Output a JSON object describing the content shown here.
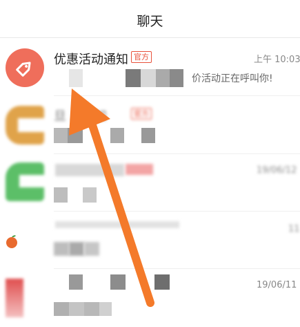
{
  "header": {
    "title": "聊天"
  },
  "chats": [
    {
      "name": "优惠活动通知",
      "badge": "官方",
      "time": "上午 10:03",
      "preview": "价活动正在呼叫你!",
      "avatar_color": "#ef6e5b",
      "avatar_icon": "tag-icon"
    },
    {
      "name": "旦 ...通知",
      "badge": "官方",
      "time": "",
      "preview": "",
      "avatar_color": "#e0a34a"
    },
    {
      "name": "",
      "badge": "",
      "time": "19/06/12",
      "preview": "",
      "avatar_color": "#5cbf68"
    },
    {
      "name": "",
      "badge": "",
      "time": "11",
      "preview": "",
      "avatar_color": "#e86a2e"
    },
    {
      "name": "",
      "badge": "",
      "time": "19/06/11",
      "preview": "",
      "avatar_color": "#e05050"
    }
  ],
  "overlay": {
    "arrow_color": "#f47a2a",
    "arrow_icon": "pointer-arrow-icon"
  }
}
